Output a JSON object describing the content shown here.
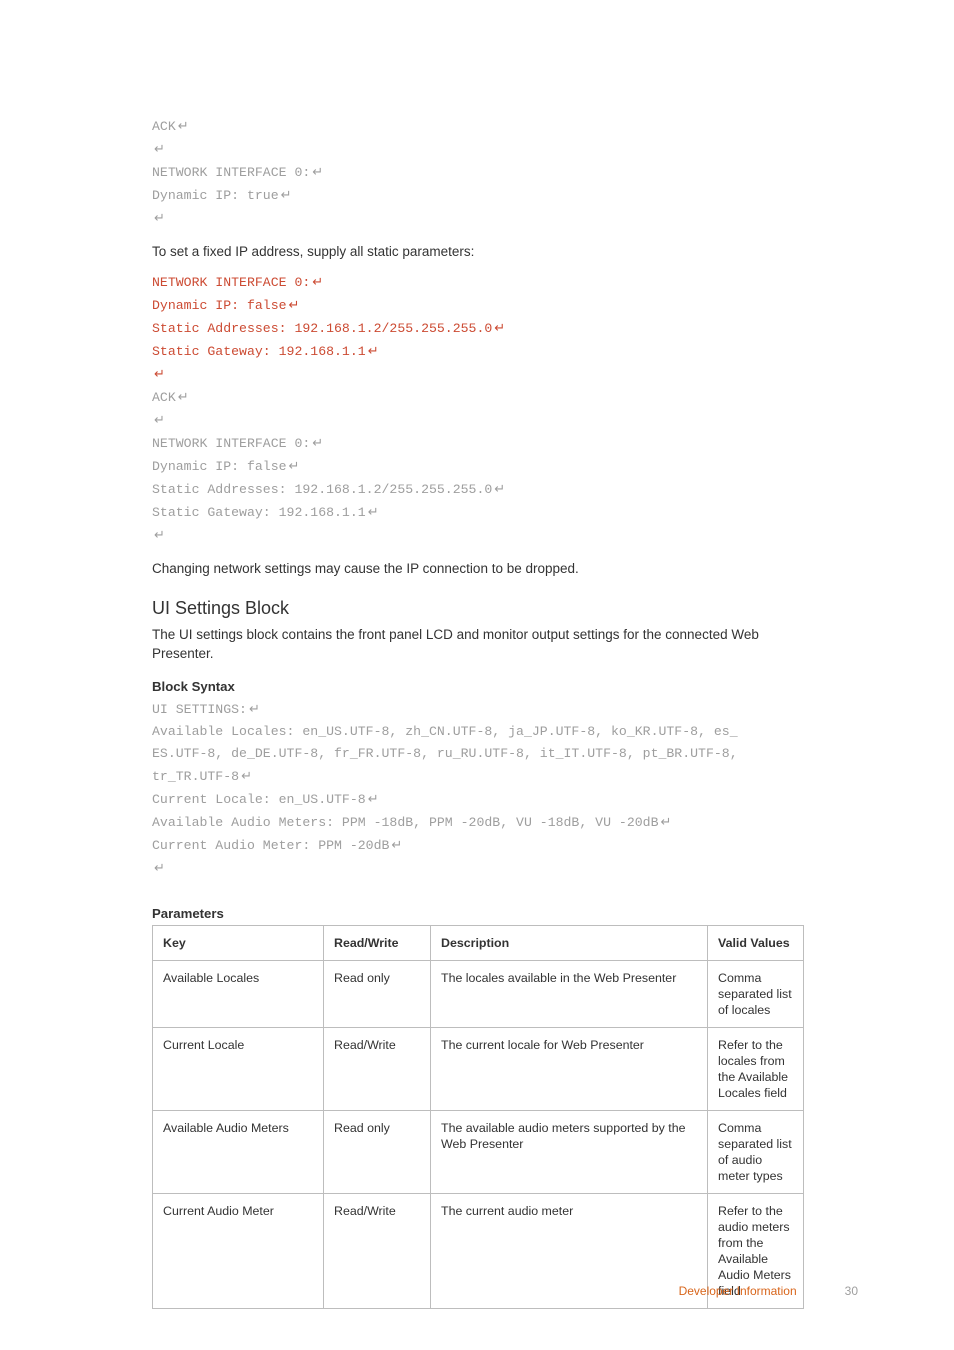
{
  "code_block_1": {
    "l1_a": "ACK",
    "l2_ret_only": "",
    "l3_a": "NETWORK INTERFACE 0:",
    "l4_a": "Dynamic IP: true",
    "l5_ret_only": ""
  },
  "para1": "To set a fixed IP address, supply all static parameters:",
  "code_block_2": {
    "r1": "NETWORK INTERFACE 0:",
    "r2": "Dynamic IP: false",
    "r3": "Static Addresses: 192.168.1.2/255.255.255.0",
    "r4": "Static Gateway: 192.168.1.1",
    "r5_ret_only": "",
    "g1": "ACK",
    "g2_ret_only": "",
    "g3": "NETWORK INTERFACE 0:",
    "g4": "Dynamic IP: false",
    "g5": "Static Addresses: 192.168.1.2/255.255.255.0",
    "g6": "Static Gateway: 192.168.1.1",
    "g7_ret_only": ""
  },
  "para2": "Changing network settings may cause the IP connection to be dropped.",
  "h2": "UI Settings Block",
  "para3": "The UI settings block contains the front panel LCD and monitor output settings for the connected Web Presenter.",
  "block_syntax_label": "Block Syntax",
  "code_block_3": {
    "l1": "UI SETTINGS:",
    "l2a": "Available Locales: en_US.UTF-8, zh_CN.UTF-8, ja_JP.UTF-8, ko_KR.UTF-8, es_",
    "l2b": "ES.UTF-8, de_DE.UTF-8, fr_FR.UTF-8, ru_RU.UTF-8, it_IT.UTF-8, pt_BR.UTF-8, ",
    "l2c": "tr_TR.UTF-8",
    "l3": "Current Locale: en_US.UTF-8",
    "l4": "Available Audio Meters: PPM -18dB, PPM -20dB, VU -18dB, VU -20dB",
    "l5": "Current Audio Meter: PPM -20dB",
    "l6_ret_only": ""
  },
  "parameters_label": "Parameters",
  "table": {
    "headers": {
      "key": "Key",
      "rw": "Read/Write",
      "desc": "Description",
      "vv": "Valid Values"
    },
    "rows": [
      {
        "key": "Available Locales",
        "rw": "Read only",
        "desc": "The locales available in the Web Presenter",
        "vv": "Comma separated list of locales"
      },
      {
        "key": "Current Locale",
        "rw": "Read/Write",
        "desc": "The current locale for Web Presenter",
        "vv": "Refer to the locales from the Available Locales field"
      },
      {
        "key": "Available Audio Meters",
        "rw": "Read only",
        "desc": "The available audio meters supported by the Web Presenter",
        "vv": "Comma separated list of audio meter types"
      },
      {
        "key": "Current Audio Meter",
        "rw": "Read/Write",
        "desc": "The current audio meter",
        "vv": "Refer to the audio meters from the Available Audio Meters field"
      }
    ]
  },
  "footer": {
    "section": "Developer Information",
    "page": "30"
  },
  "ret_symbol": "↵"
}
